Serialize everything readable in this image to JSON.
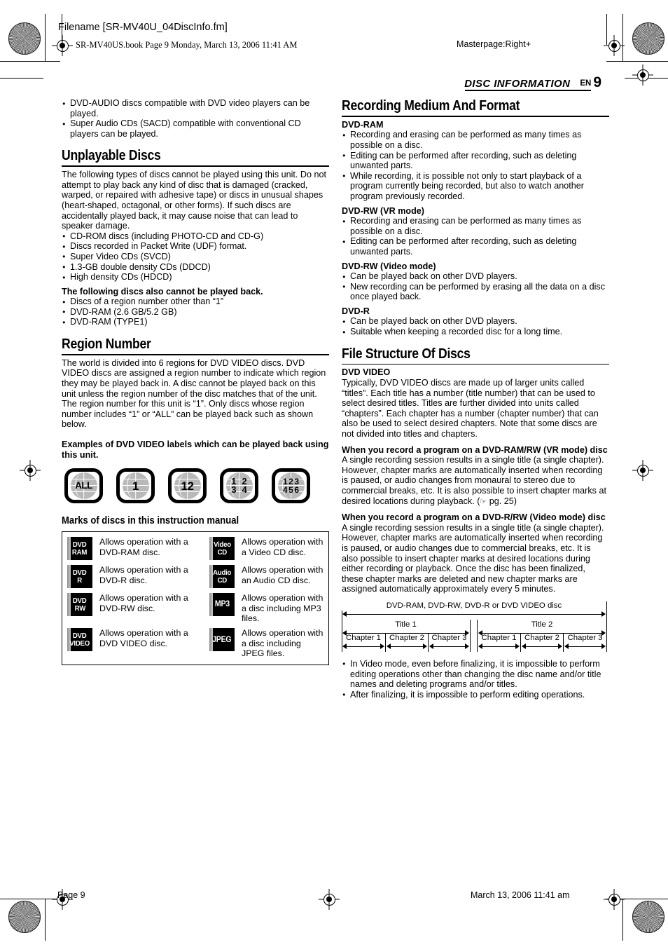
{
  "header": {
    "filename": "Filename [SR-MV40U_04DiscInfo.fm]",
    "book_line": "SR-MV40US.book  Page 9  Monday, March 13, 2006  11:41 AM",
    "masterpage": "Masterpage:Right+",
    "running_title": "DISC INFORMATION",
    "lang_code": "EN",
    "page_number": "9"
  },
  "footer": {
    "page_label": "Page 9",
    "timestamp": "March 13, 2006 11:41 am"
  },
  "left_column": {
    "intro_bullets": [
      "DVD-AUDIO discs compatible with DVD video players can be played.",
      "Super Audio CDs (SACD) compatible with conventional CD players can be played."
    ],
    "unplayable": {
      "heading": "Unplayable Discs",
      "paragraph": "The following types of discs cannot be played using this unit. Do not attempt to play back any kind of disc that is damaged (cracked, warped, or repaired with adhesive tape) or discs in unusual shapes (heart-shaped, octagonal, or other forms). If such discs are accidentally played back, it may cause noise that can lead to speaker damage.",
      "bullets": [
        "CD-ROM discs (including PHOTO-CD and CD-G)",
        "Discs recorded in Packet Write (UDF) format.",
        "Super Video CDs (SVCD)",
        "1.3-GB double density CDs (DDCD)",
        "High density CDs (HDCD)"
      ],
      "subheading": "The following discs also cannot be played back.",
      "sub_bullets": [
        "Discs of a region number other than “1”",
        "DVD-RAM (2.6 GB/5.2 GB)",
        "DVD-RAM (TYPE1)"
      ]
    },
    "region": {
      "heading": "Region Number",
      "paragraph": "The world is divided into 6 regions for DVD VIDEO discs. DVD VIDEO discs are assigned a region number to indicate which region they may be played back in. A disc cannot be played back on this unit unless the region number of the disc matches that of the unit. The region number for this unit is “1”. Only discs whose region number includes “1” or “ALL” can be played back such as shown below.",
      "examples_heading": "Examples of DVD VIDEO labels which can be played back using this unit.",
      "icons": [
        {
          "name": "region-icon-all",
          "type": "text",
          "text": "ALL"
        },
        {
          "name": "region-icon-1",
          "type": "text",
          "text": "1"
        },
        {
          "name": "region-icon-12",
          "type": "text",
          "text": "12"
        },
        {
          "name": "region-icon-1234",
          "type": "grid2",
          "cells": [
            "1",
            "2",
            "3",
            "4"
          ]
        },
        {
          "name": "region-icon-123456",
          "type": "grid3",
          "cells": [
            "1",
            "2",
            "3",
            "4",
            "5",
            "6"
          ]
        }
      ]
    },
    "marks": {
      "title": "Marks of discs in this instruction manual",
      "rows": [
        {
          "left": {
            "badge": [
              "DVD",
              "RAM"
            ],
            "icon_name": "dvd-ram-mark-icon",
            "desc": "Allows operation with a DVD-RAM disc."
          },
          "right": {
            "badge": [
              "Video",
              "CD"
            ],
            "icon_name": "video-cd-mark-icon",
            "desc": "Allows operation with a Video CD disc."
          }
        },
        {
          "left": {
            "badge": [
              "DVD",
              "R"
            ],
            "icon_name": "dvd-r-mark-icon",
            "desc": "Allows operation with a DVD-R disc."
          },
          "right": {
            "badge": [
              "Audio",
              "CD"
            ],
            "icon_name": "audio-cd-mark-icon",
            "desc": "Allows operation with an Audio CD disc."
          }
        },
        {
          "left": {
            "badge": [
              "DVD",
              "RW"
            ],
            "icon_name": "dvd-rw-mark-icon",
            "desc": "Allows operation with a DVD-RW disc."
          },
          "right": {
            "badge": [
              "MP3"
            ],
            "icon_name": "mp3-mark-icon",
            "desc": "Allows operation with a disc including MP3 files."
          }
        },
        {
          "left": {
            "badge": [
              "DVD",
              "VIDEO"
            ],
            "icon_name": "dvd-video-mark-icon",
            "desc": "Allows operation with a DVD VIDEO disc."
          },
          "right": {
            "badge": [
              "JPEG"
            ],
            "icon_name": "jpeg-mark-icon",
            "desc": "Allows operation with a disc including JPEG files."
          }
        }
      ]
    }
  },
  "right_column": {
    "recording": {
      "heading": "Recording Medium And Format",
      "groups": [
        {
          "label": "DVD-RAM",
          "bullets": [
            "Recording and erasing can be performed as many times as possible on a disc.",
            "Editing can be performed after recording, such as deleting unwanted parts.",
            "While recording, it is possible not only to start playback of a program currently being recorded, but also to watch another program previously recorded."
          ]
        },
        {
          "label": "DVD-RW (VR mode)",
          "bullets": [
            "Recording and erasing can be performed as many times as possible on a disc.",
            "Editing can be performed after recording, such as deleting unwanted parts."
          ]
        },
        {
          "label": "DVD-RW (Video mode)",
          "bullets": [
            "Can be played back on other DVD players.",
            "New recording can be performed by erasing all the data on a disc once played back."
          ]
        },
        {
          "label": "DVD-R",
          "bullets": [
            "Can be played back on other DVD players.",
            "Suitable when keeping a recorded disc for a long time."
          ]
        }
      ]
    },
    "file_structure": {
      "heading": "File Structure Of Discs",
      "dvd_video_label": "DVD VIDEO",
      "dvd_video_text": "Typically, DVD VIDEO discs are made up of larger units called “titles”. Each title has a number (title number) that can be used to select desired titles. Titles are further divided into units called “chapters”. Each chapter has a number (chapter number) that can also be used to select desired chapters. Note that some discs are not divided into titles and chapters.",
      "vr_heading": "When you record a program on a DVD-RAM/RW (VR mode) disc",
      "vr_text_a": "A single recording session results in a single title (a single chapter). However, chapter marks are automatically inserted when recording is paused, or audio changes from monaural to stereo due to commercial breaks, etc. It is also possible to insert chapter marks at desired locations during playback. (",
      "vr_text_b": " pg. 25)",
      "video_heading": "When you record a program on a DVD-R/RW (Video mode) disc",
      "video_text": "A single recording session results in a single title (a single chapter). However, chapter marks are automatically inserted when recording is paused, or audio changes due to commercial breaks, etc. It is also possible to insert chapter marks at desired locations during either recording or playback. Once the disc has been finalized, these chapter marks are deleted and new chapter marks are assigned automatically approximately every 5 minutes.",
      "closing_bullets": [
        "In Video mode, even before finalizing, it is impossible to perform editing operations other than changing the disc name and/or title names and deleting programs and/or titles.",
        "After finalizing, it is impossible to perform editing operations."
      ]
    },
    "diagram": {
      "disc_label": "DVD-RAM, DVD-RW, DVD-R or DVD VIDEO disc",
      "titles": [
        "Title 1",
        "Title 2"
      ],
      "chapters_title1": [
        "Chapter 1",
        "Chapter 2",
        "Chapter 3"
      ],
      "chapters_title2": [
        "Chapter 1",
        "Chapter 2",
        "Chapter 3"
      ]
    }
  }
}
